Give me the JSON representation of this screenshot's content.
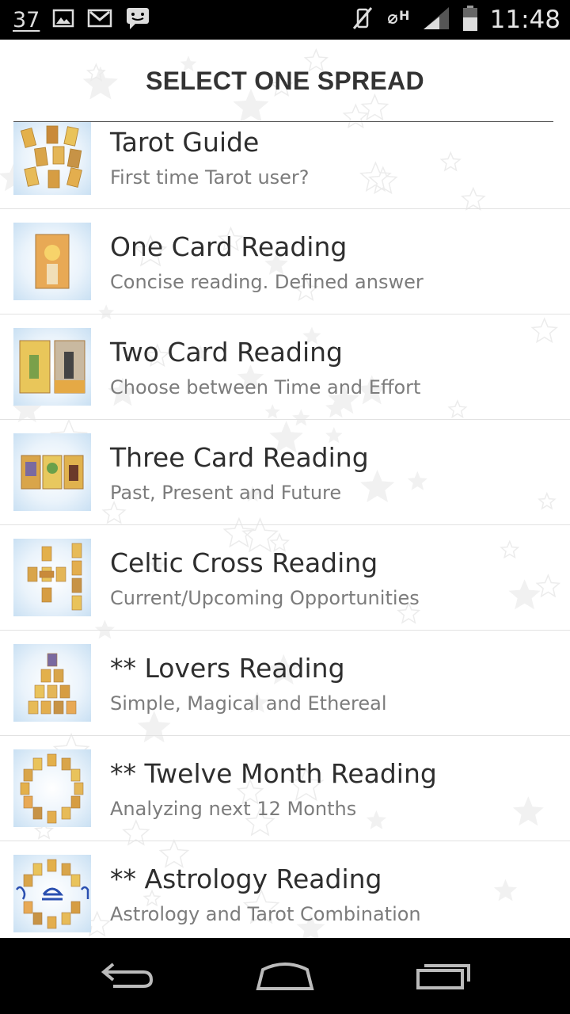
{
  "status_bar": {
    "notification_count": "37",
    "time": "11:48",
    "left_icons": [
      "image-icon",
      "gmail-icon",
      "chat-icon"
    ],
    "right_icons": [
      "vibrate-off-icon",
      "data-h-icon",
      "signal-icon",
      "battery-icon"
    ]
  },
  "header": {
    "title": "SELECT ONE SPREAD"
  },
  "spreads": [
    {
      "title": "Tarot Guide",
      "subtitle": "First time Tarot user?",
      "icon": "tarot-guide-icon"
    },
    {
      "title": "One Card Reading",
      "subtitle": "Concise reading. Defined answer",
      "icon": "one-card-icon"
    },
    {
      "title": "Two Card Reading",
      "subtitle": "Choose between Time and Effort",
      "icon": "two-card-icon"
    },
    {
      "title": "Three Card Reading",
      "subtitle": "Past, Present and Future",
      "icon": "three-card-icon"
    },
    {
      "title": "Celtic Cross Reading",
      "subtitle": "Current/Upcoming Opportunities",
      "icon": "celtic-cross-icon"
    },
    {
      "title": "** Lovers Reading",
      "subtitle": "Simple, Magical and Ethereal",
      "icon": "lovers-icon"
    },
    {
      "title": "** Twelve Month Reading",
      "subtitle": "Analyzing next 12 Months",
      "icon": "twelve-month-icon"
    },
    {
      "title": "** Astrology Reading",
      "subtitle": "Astrology and Tarot Combination",
      "icon": "astrology-icon"
    }
  ],
  "navbar": {
    "icons": [
      "back-icon",
      "home-icon",
      "recent-apps-icon"
    ]
  },
  "colors": {
    "title": "#2e2e2e",
    "subtitle": "#7c7c7c",
    "header": "#333333",
    "thumb_bg": "#c9e0f3",
    "card": "#e8b84a"
  }
}
